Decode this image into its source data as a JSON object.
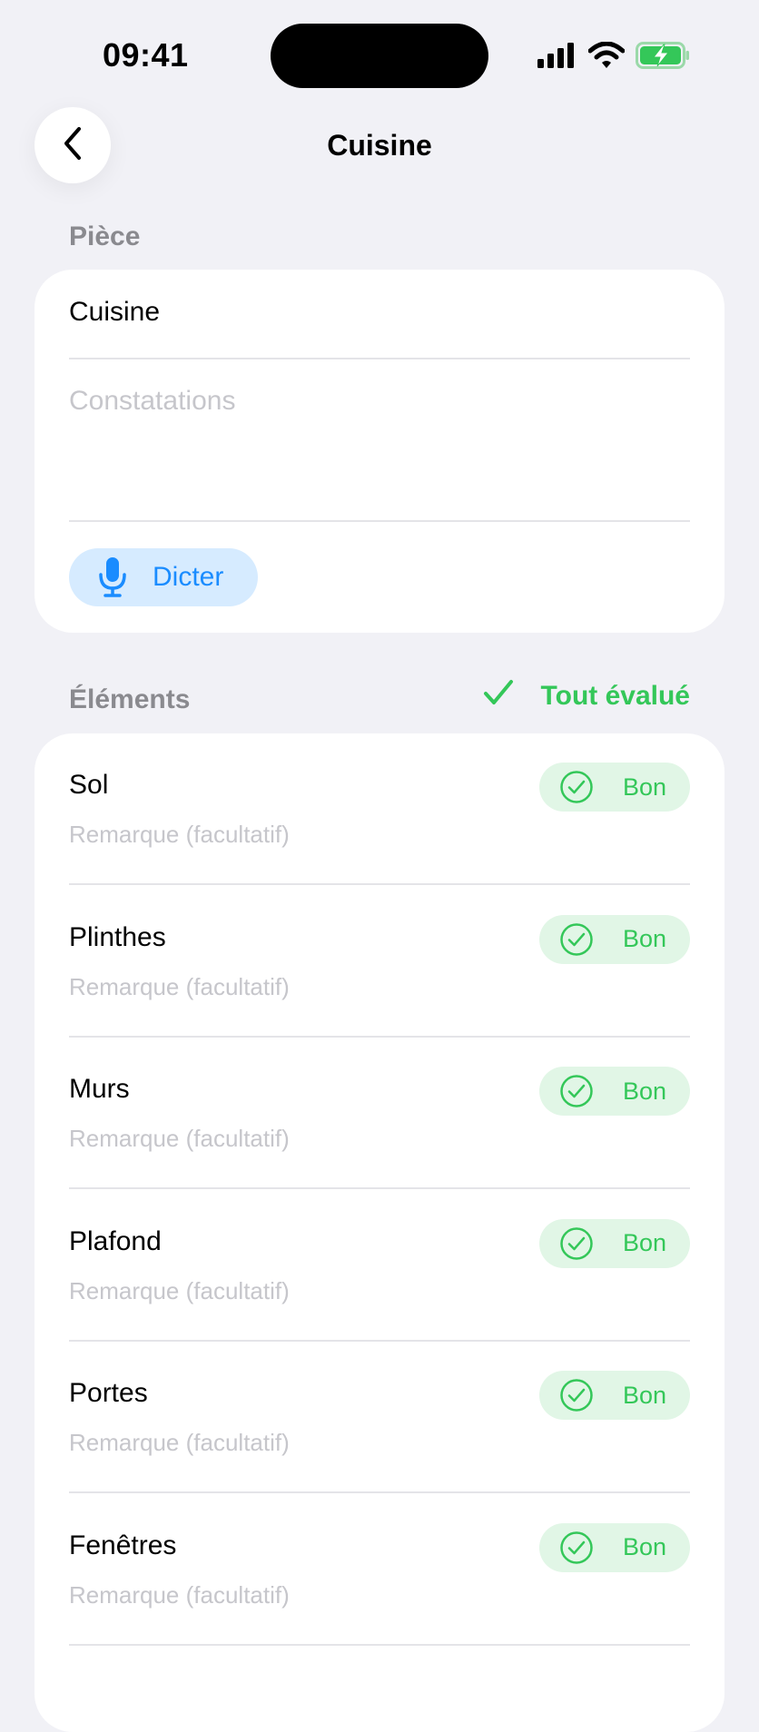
{
  "status_bar": {
    "time": "09:41",
    "icons": [
      "signal-icon",
      "wifi-icon",
      "battery-charging-icon"
    ],
    "battery_color": "#34C759"
  },
  "nav": {
    "title": "Cuisine",
    "back_icon": "chevron-left-icon"
  },
  "room_section": {
    "label": "Pièce",
    "room_name": "Cuisine",
    "observations_placeholder": "Constatations",
    "dictate_label": "Dicter",
    "dictate_icon": "microphone-icon"
  },
  "elements_section": {
    "label": "Éléments",
    "all_evaluated_label": "Tout évalué",
    "accent_color": "#34C759",
    "remark_placeholder": "Remarque (facultatif)",
    "items": [
      {
        "name": "Sol",
        "status": "Bon"
      },
      {
        "name": "Plinthes",
        "status": "Bon"
      },
      {
        "name": "Murs",
        "status": "Bon"
      },
      {
        "name": "Plafond",
        "status": "Bon"
      },
      {
        "name": "Portes",
        "status": "Bon"
      },
      {
        "name": "Fenêtres",
        "status": "Bon"
      }
    ]
  }
}
